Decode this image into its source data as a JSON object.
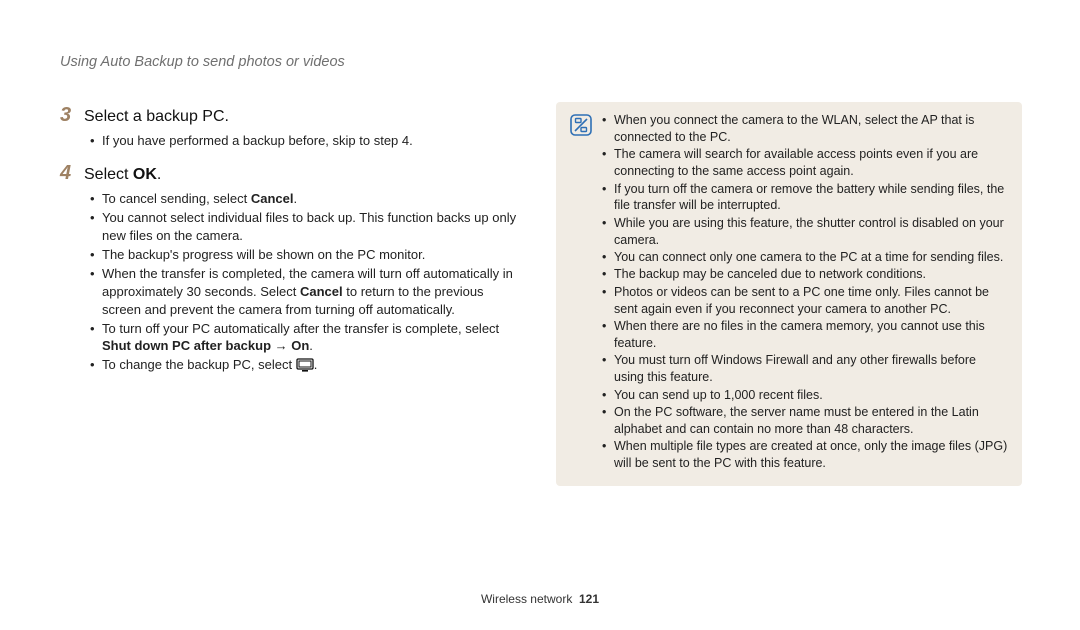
{
  "header": "Using Auto Backup to send photos or videos",
  "step3": {
    "num": "3",
    "text": "Select a backup PC."
  },
  "step3_bullets": [
    "If you have performed a backup before, skip to step 4."
  ],
  "step4": {
    "num": "4",
    "prefix": "Select ",
    "bold": "OK",
    "suffix": "."
  },
  "step4_bullets": {
    "b1_pre": "To cancel sending, select ",
    "b1_bold": "Cancel",
    "b1_post": ".",
    "b2": "You cannot select individual files to back up. This function backs up only new files on the camera.",
    "b3": "The backup's progress will be shown on the PC monitor.",
    "b4_pre": "When the transfer is completed, the camera will turn off automatically in approximately 30 seconds. Select ",
    "b4_bold": "Cancel",
    "b4_post": " to return to the previous screen and prevent the camera from turning off automatically.",
    "b5_pre": "To turn off your PC automatically after the transfer is complete, select ",
    "b5_bold": "Shut down PC after backup → On",
    "b5_post": ".",
    "b6_pre": "To change the backup PC, select ",
    "b6_post": "."
  },
  "notes": [
    "When you connect the camera to the WLAN, select the AP that is connected to the PC.",
    "The camera will search for available access points even if you are connecting to the same access point again.",
    "If you turn off the camera or remove the battery while sending files, the file transfer will be interrupted.",
    "While you are using this feature, the shutter control is disabled on your camera.",
    "You can connect only one camera to the PC at a time for sending files.",
    "The backup may be canceled due to network conditions.",
    "Photos or videos can be sent to a PC one time only. Files cannot be sent again even if you reconnect your camera to another PC.",
    "When there are no files in the camera memory, you cannot use this feature.",
    "You must turn off Windows Firewall and any other firewalls before using this feature.",
    "You can send up to 1,000 recent files.",
    "On the PC software, the server name must be entered in the Latin alphabet and can contain no more than 48 characters.",
    "When multiple file types are created at once, only the image files (JPG) will be sent to the PC with this feature."
  ],
  "footer": {
    "section": "Wireless network",
    "page": "121"
  }
}
